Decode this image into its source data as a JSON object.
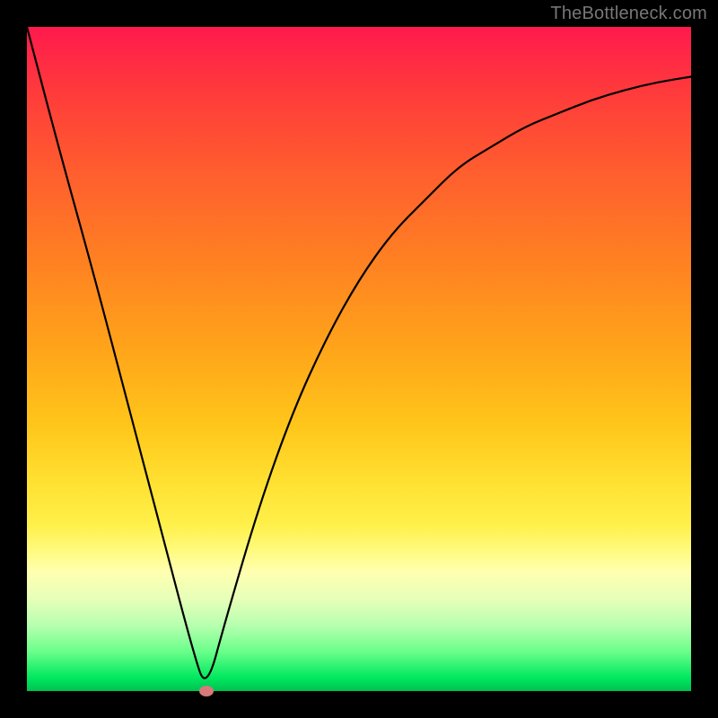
{
  "watermark": "TheBottleneck.com",
  "chart_data": {
    "type": "line",
    "title": "",
    "xlabel": "",
    "ylabel": "",
    "xlim": [
      0,
      100
    ],
    "ylim": [
      0,
      100
    ],
    "grid": false,
    "legend": false,
    "series": [
      {
        "name": "curve",
        "x": [
          0,
          5,
          10,
          15,
          20,
          25,
          27,
          30,
          35,
          40,
          45,
          50,
          55,
          60,
          65,
          70,
          75,
          80,
          85,
          90,
          95,
          100
        ],
        "y": [
          100,
          81,
          63,
          44,
          25,
          6,
          0,
          11,
          28,
          42,
          53,
          62,
          69,
          74,
          79,
          82,
          85,
          87,
          89,
          90.5,
          91.7,
          92.5
        ]
      }
    ],
    "minimum_point": {
      "x": 27,
      "y": 0
    },
    "background_gradient": {
      "top_color": "#ff1a4d",
      "bottom_color": "#00c050"
    }
  }
}
